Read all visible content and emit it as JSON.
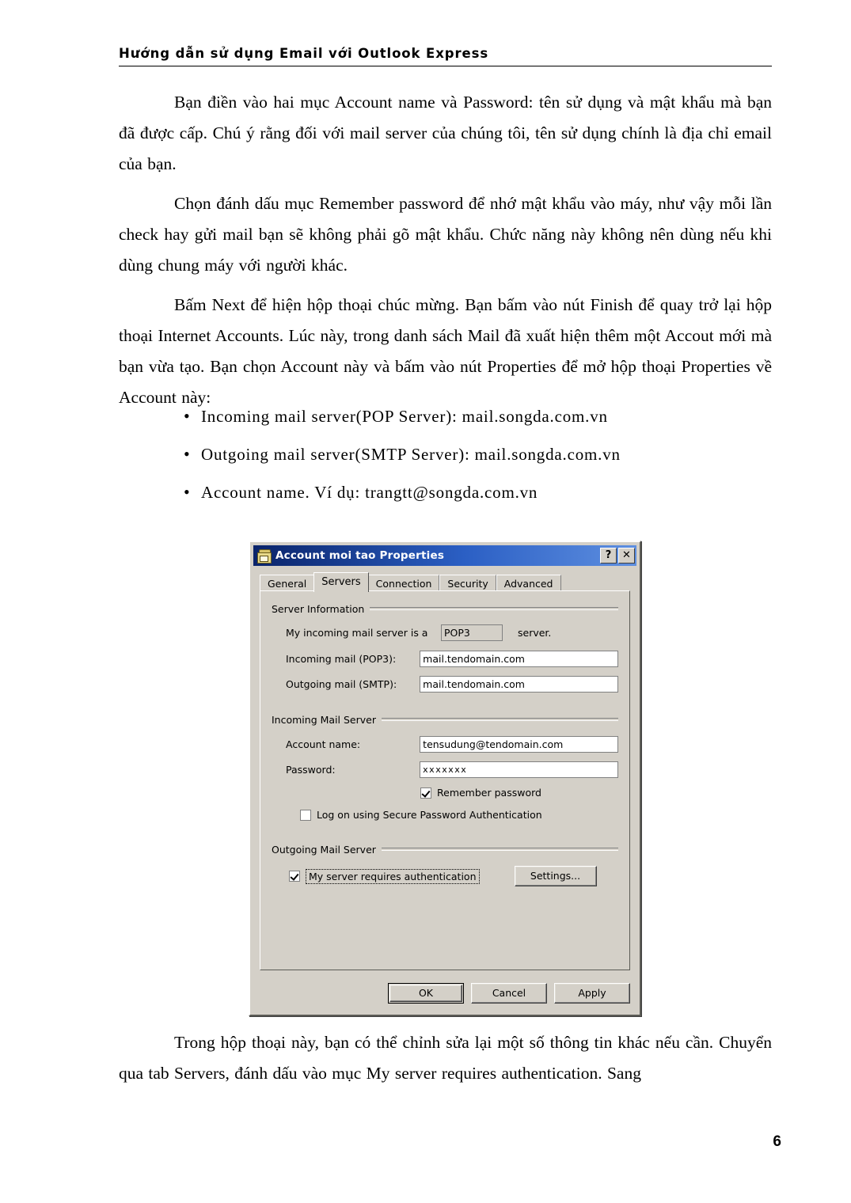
{
  "page": {
    "header_title": "Hướng dẫn sử dụng Email với Outlook Express",
    "number": "6"
  },
  "document": {
    "paragraphs": [
      "Bạn điền vào hai mục Account name và Password: tên sử dụng và mật khẩu mà bạn đã được cấp. Chú ý rằng đối với mail server của chúng tôi, tên sử dụng chính là địa chỉ email của bạn.",
      "Chọn đánh dấu mục Remember password để nhớ mật khẩu vào máy, như vậy mỗi lần check hay gửi mail bạn sẽ không phải gõ mật khẩu. Chức năng này không nên dùng nếu khi  dùng chung máy với người khác.",
      "Bấm Next để hiện hộp thoại chúc mừng. Bạn bấm vào nút Finish để quay trở lại hộp thoại Internet Accounts. Lúc này, trong danh sách Mail đã xuất hiện thêm một Accout mới mà bạn vừa tạo. Bạn chọn Account này và bấm vào nút Properties để mở hộp thoại Properties về Account này:"
    ],
    "bullet_marker": "•",
    "bullets": [
      "Incoming mail server(POP Server): mail.songda.com.vn",
      "Outgoing mail server(SMTP Server): mail.songda.com.vn",
      "Account name. Ví dụ: trangtt@songda.com.vn"
    ],
    "closing_paragraph": "Trong hộp thoại này, bạn có thể chỉnh sửa lại một số thông tin khác nếu cần. Chuyển qua tab Servers, đánh dấu vào mục My server requires authentication.  Sang"
  },
  "dialog": {
    "title": "Account moi tao Properties",
    "icon": "mail-account-icon",
    "titlebar_buttons": [
      {
        "name": "help-button",
        "glyph": "?"
      },
      {
        "name": "close-button",
        "glyph": "✕"
      }
    ],
    "tabs": [
      {
        "label": "General",
        "active": false
      },
      {
        "label": "Servers",
        "active": true
      },
      {
        "label": "Connection",
        "active": false
      },
      {
        "label": "Security",
        "active": false
      },
      {
        "label": "Advanced",
        "active": false
      }
    ],
    "server_information": {
      "group_label": "Server Information",
      "incoming_type_prefix": "My incoming mail server is a",
      "incoming_type_value": "POP3",
      "incoming_type_suffix": "server.",
      "incoming_label": "Incoming mail (POP3):",
      "incoming_value": "mail.tendomain.com",
      "outgoing_label": "Outgoing mail (SMTP):",
      "outgoing_value": "mail.tendomain.com"
    },
    "incoming_mail_server": {
      "group_label": "Incoming Mail Server",
      "account_name_label": "Account name:",
      "account_name_value": "tensudung@tendomain.com",
      "password_label": "Password:",
      "password_value": "•••••••",
      "password_mask": "xxxxxxx",
      "remember_password_label": "Remember password",
      "remember_password_checked": true,
      "spa_label": "Log on using Secure Password Authentication",
      "spa_checked": false
    },
    "outgoing_mail_server": {
      "group_label": "Outgoing Mail Server",
      "requires_auth_label": "My server requires authentication",
      "requires_auth_checked": true,
      "requires_auth_focused": true,
      "settings_button_label": "Settings..."
    },
    "buttons": {
      "ok": "OK",
      "cancel": "Cancel",
      "apply": "Apply"
    },
    "colors": {
      "face": "#d4d0c8",
      "titlebar_start": "#0a246a",
      "titlebar_end": "#5e8fe0",
      "title_text": "#ffffff"
    }
  }
}
